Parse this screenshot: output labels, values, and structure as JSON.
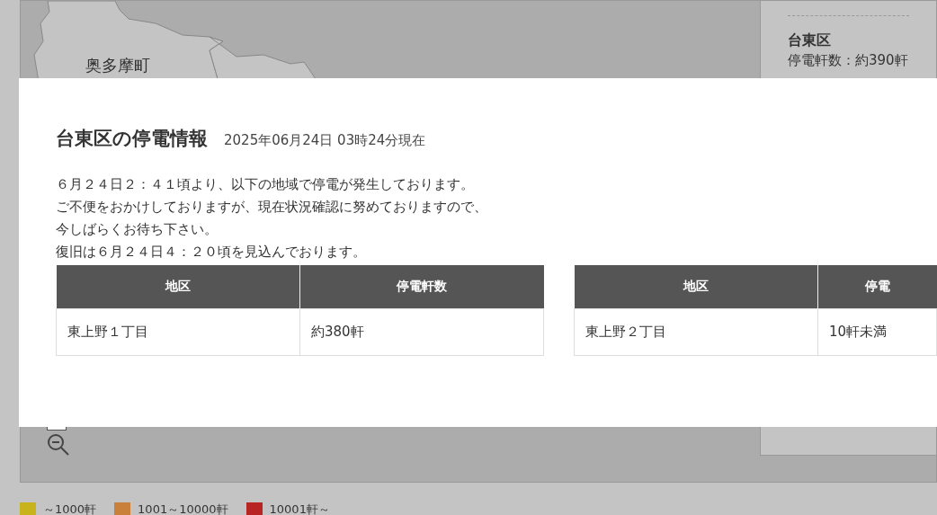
{
  "map": {
    "labels": [
      "奥多摩町"
    ]
  },
  "side_panel": {
    "area": "台東区",
    "count": "停電軒数：約390軒"
  },
  "dialog": {
    "title": "台東区の停電情報",
    "timestamp": "2025年06月24日 03時24分現在",
    "message": [
      "６月２４日２：４１頃より、以下の地域で停電が発生しております。",
      "ご不便をおかけしておりますが、現在状況確認に努めておりますので、",
      "今しばらくお待ち下さい。",
      "復旧は６月２４日４：２０頃を見込んでおります。"
    ],
    "tables": [
      {
        "columns": [
          "地区",
          "停電軒数"
        ],
        "rows": [
          [
            "東上野１丁目",
            "約380軒"
          ]
        ]
      },
      {
        "columns": [
          "地区",
          "停電"
        ],
        "rows": [
          [
            "東上野２丁目",
            "10軒未満"
          ]
        ]
      }
    ]
  },
  "legend": [
    {
      "label": "～1000軒",
      "color": "#c9b31c"
    },
    {
      "label": "1001～10000軒",
      "color": "#c9803a"
    },
    {
      "label": "10001軒～",
      "color": "#b82424"
    }
  ]
}
